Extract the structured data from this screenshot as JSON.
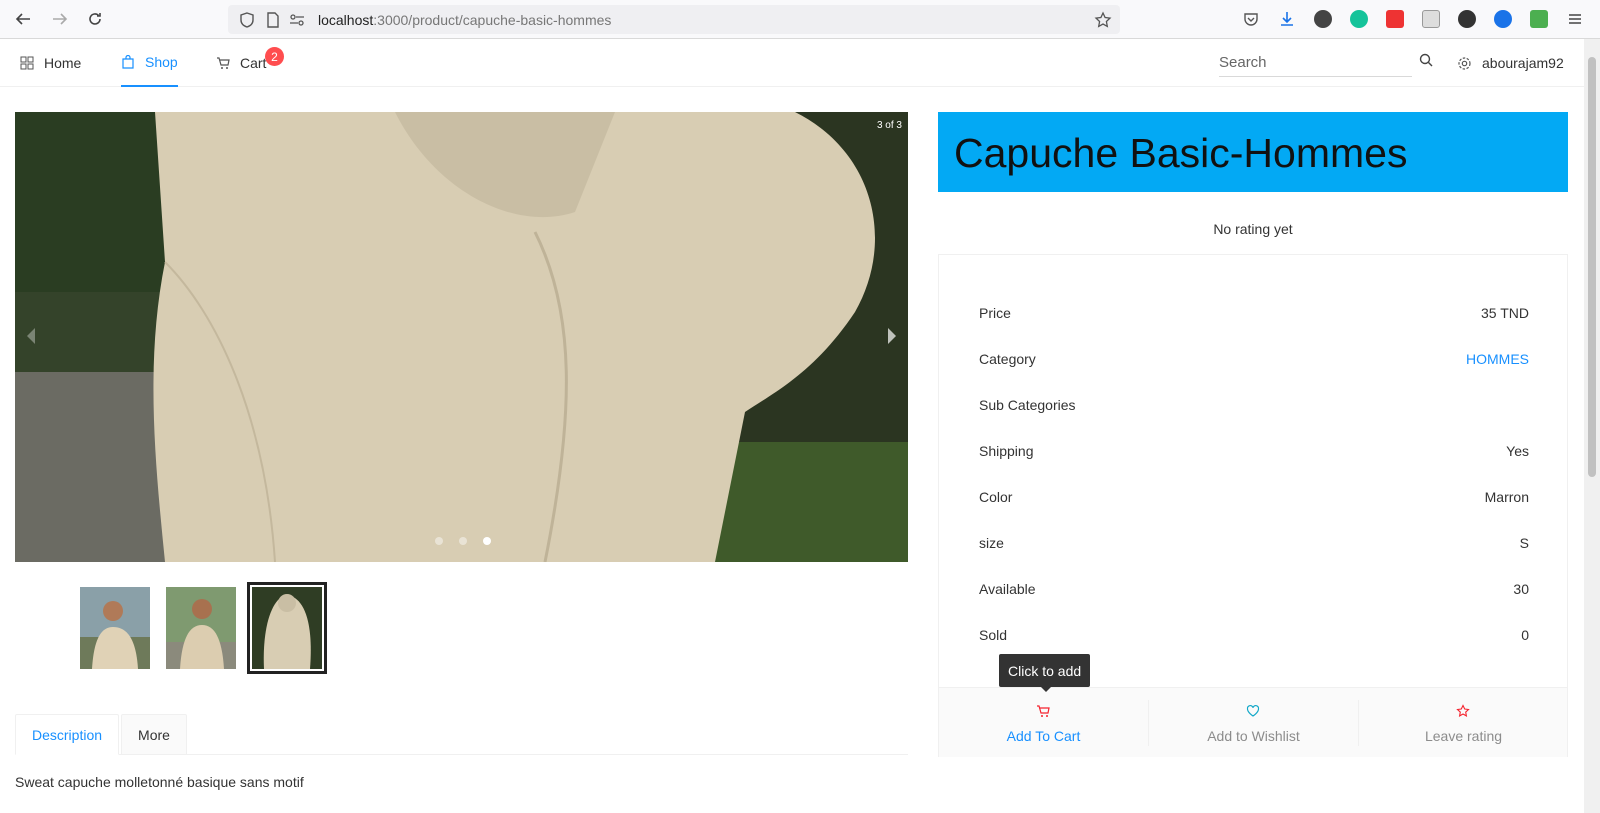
{
  "browser": {
    "url_host": "localhost",
    "url_rest": ":3000/product/capuche-basic-hommes"
  },
  "nav": {
    "home": "Home",
    "shop": "Shop",
    "cart": "Cart",
    "cart_count": "2",
    "search_placeholder": "Search",
    "user": "abourajam92"
  },
  "carousel": {
    "counter": "3 of 3",
    "slides": 3,
    "active_slide": 3
  },
  "tabs": {
    "description": "Description",
    "more": "More"
  },
  "description_text": "Sweat capuche molletonné basique sans motif",
  "product": {
    "title": "Capuche Basic-Hommes",
    "rating": "No rating yet",
    "details": [
      {
        "label": "Price",
        "value": "35 TND"
      },
      {
        "label": "Category",
        "value": "HOMMES"
      },
      {
        "label": "Sub Categories",
        "value": ""
      },
      {
        "label": "Shipping",
        "value": "Yes"
      },
      {
        "label": "Color",
        "value": "Marron"
      },
      {
        "label": "size",
        "value": "S"
      },
      {
        "label": "Available",
        "value": "30"
      },
      {
        "label": "Sold",
        "value": "0"
      }
    ],
    "actions": {
      "add_to_cart": "Add To Cart",
      "add_to_wishlist": "Add to Wishlist",
      "leave_rating": "Leave rating"
    },
    "tooltip": "Click to add"
  },
  "colors": {
    "accent": "#1890ff",
    "title_bg": "#03a9f4",
    "badge": "#ff4d4f",
    "action_icon": "#f5222d"
  }
}
